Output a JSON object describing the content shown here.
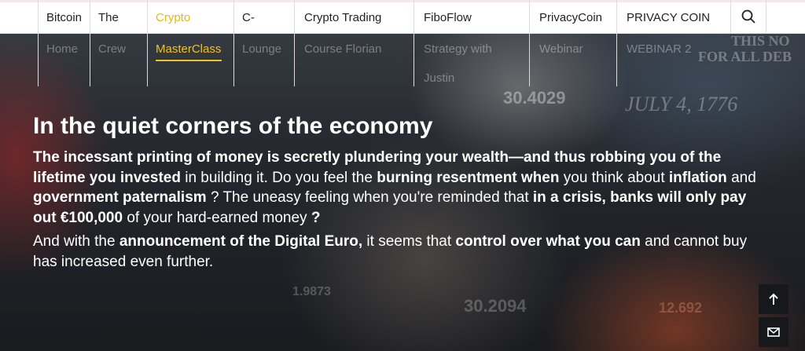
{
  "nav": {
    "items": [
      {
        "lines": [
          "Bitcoin",
          "Home"
        ],
        "active": false
      },
      {
        "lines": [
          "The",
          "Crew"
        ],
        "active": false
      },
      {
        "lines": [
          "Crypto",
          "MasterClass"
        ],
        "active": true
      },
      {
        "lines": [
          "C-",
          "Lounge"
        ],
        "active": false
      },
      {
        "lines": [
          "Crypto Trading",
          "Course Florian"
        ],
        "active": false
      },
      {
        "lines": [
          "FiboFlow",
          "Strategy with",
          "Justin"
        ],
        "active": false
      },
      {
        "lines": [
          "PrivacyCoin",
          "Webinar"
        ],
        "active": false
      },
      {
        "lines": [
          "PRIVACY COIN",
          "WEBINAR 2"
        ],
        "active": false
      }
    ],
    "search_icon": "search-icon",
    "accent_color": "#f1c21d"
  },
  "background": {
    "texts": [
      "THIS NO",
      "FOR ALL DEB",
      "30.4029",
      "JULY 4, 1776",
      "1.9873",
      "30.2094",
      "12.692"
    ]
  },
  "hero": {
    "headline": "In the quiet corners of the economy",
    "p1": [
      {
        "t": "The incessant printing of money is secretly plundering your wealth—and thus robbing you of the lifetime you invested",
        "b": true
      },
      {
        "t": " in building it. Do you feel the ",
        "b": false
      },
      {
        "t": "burning resentment when",
        "b": true
      },
      {
        "t": " you think about ",
        "b": false
      },
      {
        "t": "inflation",
        "b": true
      },
      {
        "t": " and ",
        "b": false
      },
      {
        "t": "government paternalism",
        "b": true
      },
      {
        "t": " ? The uneasy feeling when you're reminded that ",
        "b": false
      },
      {
        "t": "in a crisis, banks will only pay out €100,000",
        "b": true
      },
      {
        "t": " of your hard-earned money ",
        "b": false
      },
      {
        "t": "?",
        "b": true
      }
    ],
    "p2": [
      {
        "t": "And with the ",
        "b": false
      },
      {
        "t": "announcement of the Digital Euro,",
        "b": true
      },
      {
        "t": " it seems that ",
        "b": false
      },
      {
        "t": "control over what you can",
        "b": true
      },
      {
        "t": " and cannot buy has increased even further.",
        "b": false
      }
    ]
  },
  "floating": {
    "scroll_top_icon": "arrow-up-icon",
    "mail_icon": "mail-icon"
  }
}
